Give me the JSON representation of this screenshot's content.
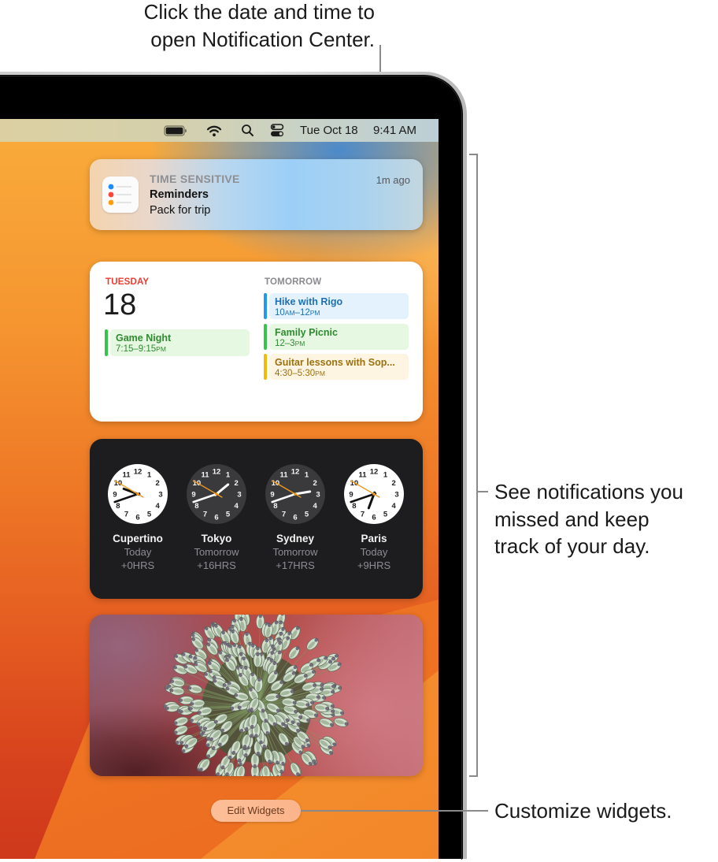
{
  "callouts": {
    "top": [
      "Click the date and time to",
      "open Notification Center."
    ],
    "right": [
      "See notifications you",
      "missed and keep",
      "track of your day."
    ],
    "bottom": "Customize widgets."
  },
  "menubar": {
    "icons": [
      "battery-icon",
      "wifi-icon",
      "search-icon",
      "control-center-icon"
    ],
    "date": "Tue Oct 18",
    "time": "9:41 AM"
  },
  "notification": {
    "app_icon": "reminders-icon",
    "category": "TIME SENSITIVE",
    "app": "Reminders",
    "message": "Pack for trip",
    "age": "1m ago"
  },
  "calendar": {
    "today": {
      "weekday": "TUESDAY",
      "day": "18",
      "events": [
        {
          "title": "Game Night",
          "time": "7:15–9:15PM",
          "bar": "#33c748",
          "bg": "#e6f7e2",
          "text": "#2f8b2f"
        }
      ]
    },
    "tomorrow": {
      "label": "TOMORROW",
      "events": [
        {
          "title": "Hike with Rigo",
          "time": "10AM–12PM",
          "bar": "#1d9bf0",
          "bg": "#e4f2fd",
          "text": "#1e6fb4"
        },
        {
          "title": "Family Picnic",
          "time": "12–3PM",
          "bar": "#33c748",
          "bg": "#e6f7e2",
          "text": "#2f8b2f"
        },
        {
          "title": "Guitar lessons with Sop...",
          "time": "4:30–5:30PM",
          "bar": "#f6b800",
          "bg": "#fdf4e2",
          "text": "#9c7210"
        }
      ]
    }
  },
  "world_clock": {
    "clocks": [
      {
        "city": "Cupertino",
        "day": "Today",
        "offset": "+0HRS",
        "hour": 9,
        "minute": 41,
        "second": 50,
        "face": "light"
      },
      {
        "city": "Tokyo",
        "day": "Tomorrow",
        "offset": "+16HRS",
        "hour": 1,
        "minute": 41,
        "second": 50,
        "face": "dark"
      },
      {
        "city": "Sydney",
        "day": "Tomorrow",
        "offset": "+17HRS",
        "hour": 2,
        "minute": 41,
        "second": 50,
        "face": "dark"
      },
      {
        "city": "Paris",
        "day": "Today",
        "offset": "+9HRS",
        "hour": 6,
        "minute": 41,
        "second": 50,
        "face": "light"
      }
    ],
    "second_hand_color": "#f19a1a"
  },
  "edit_widgets": {
    "label": "Edit Widgets"
  },
  "colors": {
    "reminder_dots": [
      "#1a8cff",
      "#ff453a",
      "#ff9f0a"
    ],
    "weekday_red": "#ec3b2f"
  }
}
